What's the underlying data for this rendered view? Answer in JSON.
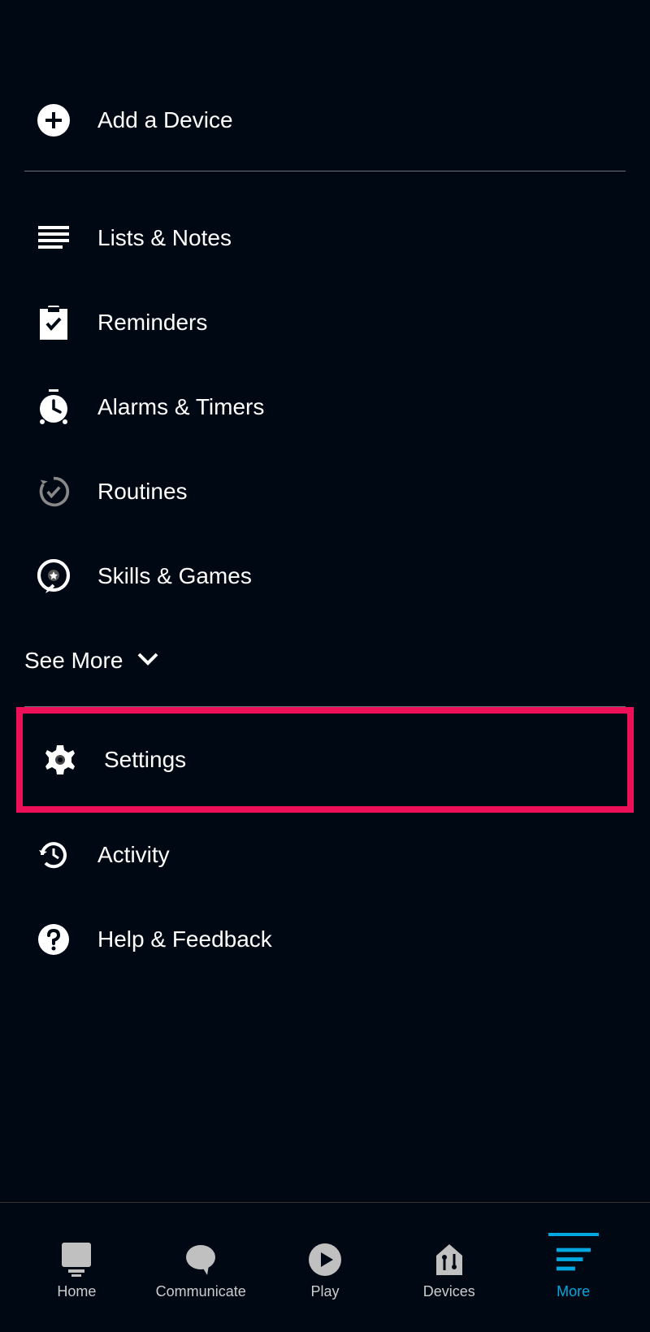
{
  "top_section": {
    "add_device_label": "Add a Device"
  },
  "menu_group1": {
    "lists_notes_label": "Lists & Notes",
    "reminders_label": "Reminders",
    "alarms_timers_label": "Alarms & Timers",
    "routines_label": "Routines",
    "skills_games_label": "Skills & Games"
  },
  "see_more_label": "See More",
  "menu_group2": {
    "settings_label": "Settings",
    "activity_label": "Activity",
    "help_feedback_label": "Help & Feedback"
  },
  "nav": {
    "home_label": "Home",
    "communicate_label": "Communicate",
    "play_label": "Play",
    "devices_label": "Devices",
    "more_label": "More"
  },
  "highlight": {
    "item": "settings",
    "color": "#ee0f59"
  },
  "colors": {
    "background": "#000814",
    "accent": "#00a8e1",
    "text": "#ffffff",
    "nav_inactive": "#cccccc"
  }
}
